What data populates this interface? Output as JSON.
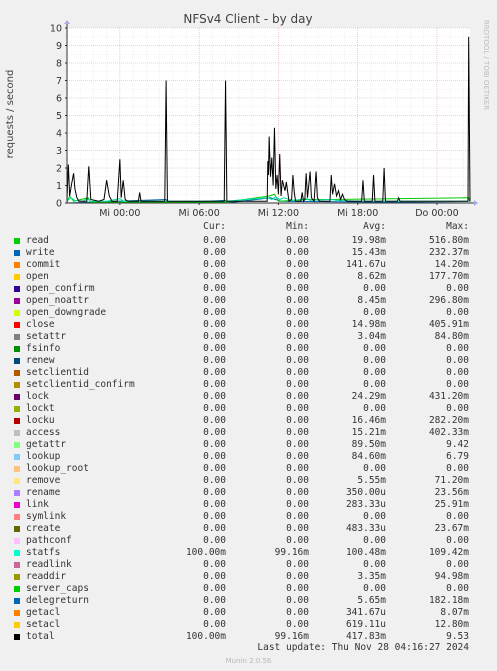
{
  "chart_data": {
    "type": "line",
    "title": "NFSv4 Client - by day",
    "ylabel": "requests / second",
    "side_label": "RRDTOOL / TOBI OETIKER",
    "ylim": [
      0,
      10
    ],
    "yticks": [
      "0",
      "1",
      "2",
      "3",
      "4",
      "5",
      "6",
      "7",
      "8",
      "9",
      "10"
    ],
    "xticks": [
      "Mi 00:00",
      "Mi 06:00",
      "Mi 12:00",
      "Mi 18:00",
      "Do 00:00"
    ],
    "grid": true,
    "x_range_hours": [
      0,
      30.5
    ],
    "xtick_hours": [
      4,
      10,
      16,
      22,
      28
    ],
    "series": [
      {
        "name": "total",
        "color": "#000000",
        "points": [
          [
            0.0,
            0.1
          ],
          [
            0.1,
            2.2
          ],
          [
            0.2,
            0.4
          ],
          [
            0.35,
            1.1
          ],
          [
            0.5,
            1.7
          ],
          [
            0.6,
            0.8
          ],
          [
            0.75,
            0.3
          ],
          [
            0.9,
            0.1
          ],
          [
            1.5,
            0.1
          ],
          [
            1.65,
            2.1
          ],
          [
            1.8,
            0.2
          ],
          [
            2.4,
            0.1
          ],
          [
            2.8,
            0.2
          ],
          [
            3.0,
            1.3
          ],
          [
            3.2,
            0.4
          ],
          [
            3.4,
            0.1
          ],
          [
            3.8,
            0.1
          ],
          [
            4.0,
            2.5
          ],
          [
            4.1,
            0.3
          ],
          [
            4.25,
            1.3
          ],
          [
            4.4,
            0.2
          ],
          [
            4.6,
            0.1
          ],
          [
            5.4,
            0.1
          ],
          [
            5.5,
            0.6
          ],
          [
            5.6,
            0.1
          ],
          [
            7.4,
            0.1
          ],
          [
            7.5,
            7.0
          ],
          [
            7.6,
            0.1
          ],
          [
            11.9,
            0.1
          ],
          [
            12.0,
            7.0
          ],
          [
            12.1,
            0.1
          ],
          [
            15.15,
            0.1
          ],
          [
            15.2,
            2.4
          ],
          [
            15.25,
            1.6
          ],
          [
            15.3,
            3.8
          ],
          [
            15.4,
            1.5
          ],
          [
            15.5,
            2.6
          ],
          [
            15.6,
            1.0
          ],
          [
            15.7,
            4.3
          ],
          [
            15.8,
            0.8
          ],
          [
            15.9,
            1.6
          ],
          [
            16.0,
            0.5
          ],
          [
            16.1,
            2.8
          ],
          [
            16.2,
            0.4
          ],
          [
            16.3,
            1.3
          ],
          [
            16.5,
            0.7
          ],
          [
            16.6,
            1.2
          ],
          [
            16.8,
            0.1
          ],
          [
            17.0,
            0.2
          ],
          [
            17.1,
            1.6
          ],
          [
            17.2,
            0.6
          ],
          [
            17.3,
            0.1
          ],
          [
            17.7,
            0.1
          ],
          [
            17.8,
            0.6
          ],
          [
            17.9,
            0.1
          ],
          [
            18.0,
            0.2
          ],
          [
            18.1,
            1.7
          ],
          [
            18.2,
            0.3
          ],
          [
            18.4,
            1.8
          ],
          [
            18.5,
            0.3
          ],
          [
            18.7,
            0.1
          ],
          [
            18.85,
            1.8
          ],
          [
            18.95,
            0.3
          ],
          [
            19.1,
            0.1
          ],
          [
            19.9,
            0.1
          ],
          [
            20.0,
            1.6
          ],
          [
            20.1,
            0.5
          ],
          [
            20.25,
            1.1
          ],
          [
            20.4,
            0.4
          ],
          [
            20.55,
            0.7
          ],
          [
            20.7,
            0.2
          ],
          [
            20.85,
            0.5
          ],
          [
            21.0,
            0.2
          ],
          [
            21.2,
            0.1
          ],
          [
            22.3,
            0.1
          ],
          [
            22.4,
            1.3
          ],
          [
            22.5,
            0.1
          ],
          [
            23.1,
            0.1
          ],
          [
            23.2,
            1.6
          ],
          [
            23.3,
            0.1
          ],
          [
            23.9,
            0.1
          ],
          [
            24.0,
            2.0
          ],
          [
            24.1,
            0.1
          ],
          [
            25.0,
            0.1
          ],
          [
            25.1,
            0.3
          ],
          [
            25.2,
            0.1
          ],
          [
            30.35,
            0.1
          ],
          [
            30.4,
            9.5
          ],
          [
            30.5,
            0.1
          ]
        ]
      },
      {
        "name": "statfs",
        "color": "#00e0a0",
        "points": [
          [
            0.0,
            0.12
          ],
          [
            0.3,
            0.3
          ],
          [
            0.6,
            0.15
          ],
          [
            1.2,
            0.1
          ],
          [
            1.5,
            0.25
          ],
          [
            1.8,
            0.1
          ],
          [
            3.0,
            0.1
          ],
          [
            4.0,
            0.25
          ],
          [
            4.3,
            0.1
          ],
          [
            7.5,
            0.1
          ],
          [
            12.0,
            0.1
          ],
          [
            15.2,
            0.3
          ],
          [
            15.5,
            0.2
          ],
          [
            15.8,
            0.35
          ],
          [
            16.1,
            0.2
          ],
          [
            16.4,
            0.3
          ],
          [
            17.1,
            0.15
          ],
          [
            18.1,
            0.25
          ],
          [
            18.4,
            0.15
          ],
          [
            20.0,
            0.2
          ],
          [
            20.4,
            0.15
          ],
          [
            22.4,
            0.1
          ],
          [
            30.4,
            0.1
          ]
        ]
      },
      {
        "name": "read",
        "color": "#00cc00",
        "points": [
          [
            0.0,
            0.05
          ],
          [
            0.2,
            0.4
          ],
          [
            0.5,
            0.1
          ],
          [
            1.6,
            0.3
          ],
          [
            1.8,
            0.05
          ],
          [
            7.5,
            0.05
          ],
          [
            12.0,
            0.05
          ],
          [
            15.3,
            0.4
          ],
          [
            15.7,
            0.5
          ],
          [
            16.0,
            0.1
          ],
          [
            18.2,
            0.2
          ],
          [
            20.1,
            0.2
          ],
          [
            30.4,
            0.3
          ],
          [
            30.5,
            0.05
          ]
        ]
      },
      {
        "name": "write",
        "color": "#0066b3",
        "points": [
          [
            0.0,
            0.0
          ],
          [
            7.5,
            0.2
          ],
          [
            7.6,
            0.0
          ],
          [
            12.0,
            0.15
          ],
          [
            12.1,
            0.0
          ],
          [
            15.4,
            0.3
          ],
          [
            15.8,
            0.2
          ],
          [
            16.2,
            0.1
          ],
          [
            30.5,
            0.0
          ]
        ]
      }
    ],
    "legend_headers": [
      "Cur:",
      "Min:",
      "Avg:",
      "Max:"
    ],
    "legend": [
      {
        "name": "read",
        "color": "#00cc00",
        "cur": "0.00",
        "min": "0.00",
        "avg": "19.98m",
        "max": "516.80m"
      },
      {
        "name": "write",
        "color": "#0066b3",
        "cur": "0.00",
        "min": "0.00",
        "avg": "15.43m",
        "max": "232.37m"
      },
      {
        "name": "commit",
        "color": "#ff8000",
        "cur": "0.00",
        "min": "0.00",
        "avg": "141.67u",
        "max": "14.20m"
      },
      {
        "name": "open",
        "color": "#ffcc00",
        "cur": "0.00",
        "min": "0.00",
        "avg": "8.62m",
        "max": "177.70m"
      },
      {
        "name": "open_confirm",
        "color": "#330099",
        "cur": "0.00",
        "min": "0.00",
        "avg": "0.00",
        "max": "0.00"
      },
      {
        "name": "open_noattr",
        "color": "#990099",
        "cur": "0.00",
        "min": "0.00",
        "avg": "8.45m",
        "max": "296.80m"
      },
      {
        "name": "open_downgrade",
        "color": "#ccff00",
        "cur": "0.00",
        "min": "0.00",
        "avg": "0.00",
        "max": "0.00"
      },
      {
        "name": "close",
        "color": "#ff0000",
        "cur": "0.00",
        "min": "0.00",
        "avg": "14.98m",
        "max": "405.91m"
      },
      {
        "name": "setattr",
        "color": "#808080",
        "cur": "0.00",
        "min": "0.00",
        "avg": "3.04m",
        "max": "84.80m"
      },
      {
        "name": "fsinfo",
        "color": "#008f00",
        "cur": "0.00",
        "min": "0.00",
        "avg": "0.00",
        "max": "0.00"
      },
      {
        "name": "renew",
        "color": "#00487d",
        "cur": "0.00",
        "min": "0.00",
        "avg": "0.00",
        "max": "0.00"
      },
      {
        "name": "setclientid",
        "color": "#b35a00",
        "cur": "0.00",
        "min": "0.00",
        "avg": "0.00",
        "max": "0.00"
      },
      {
        "name": "setclientid_confirm",
        "color": "#b38f00",
        "cur": "0.00",
        "min": "0.00",
        "avg": "0.00",
        "max": "0.00"
      },
      {
        "name": "lock",
        "color": "#6b006b",
        "cur": "0.00",
        "min": "0.00",
        "avg": "24.29m",
        "max": "431.20m"
      },
      {
        "name": "lockt",
        "color": "#8fb300",
        "cur": "0.00",
        "min": "0.00",
        "avg": "0.00",
        "max": "0.00"
      },
      {
        "name": "locku",
        "color": "#b30000",
        "cur": "0.00",
        "min": "0.00",
        "avg": "16.46m",
        "max": "282.20m"
      },
      {
        "name": "access",
        "color": "#bebebe",
        "cur": "0.00",
        "min": "0.00",
        "avg": "15.21m",
        "max": "402.33m"
      },
      {
        "name": "getattr",
        "color": "#80ff80",
        "cur": "0.00",
        "min": "0.00",
        "avg": "89.50m",
        "max": "9.42"
      },
      {
        "name": "lookup",
        "color": "#80c9ff",
        "cur": "0.00",
        "min": "0.00",
        "avg": "84.60m",
        "max": "6.79"
      },
      {
        "name": "lookup_root",
        "color": "#ffc080",
        "cur": "0.00",
        "min": "0.00",
        "avg": "0.00",
        "max": "0.00"
      },
      {
        "name": "remove",
        "color": "#ffe680",
        "cur": "0.00",
        "min": "0.00",
        "avg": "5.55m",
        "max": "71.20m"
      },
      {
        "name": "rename",
        "color": "#aa80ff",
        "cur": "0.00",
        "min": "0.00",
        "avg": "350.00u",
        "max": "23.56m"
      },
      {
        "name": "link",
        "color": "#ee00cc",
        "cur": "0.00",
        "min": "0.00",
        "avg": "283.33u",
        "max": "25.91m"
      },
      {
        "name": "symlink",
        "color": "#ff8080",
        "cur": "0.00",
        "min": "0.00",
        "avg": "0.00",
        "max": "0.00"
      },
      {
        "name": "create",
        "color": "#666600",
        "cur": "0.00",
        "min": "0.00",
        "avg": "483.33u",
        "max": "23.67m"
      },
      {
        "name": "pathconf",
        "color": "#ffbfff",
        "cur": "0.00",
        "min": "0.00",
        "avg": "0.00",
        "max": "0.00"
      },
      {
        "name": "statfs",
        "color": "#00ffcc",
        "cur": "100.00m",
        "min": "99.16m",
        "avg": "100.48m",
        "max": "109.42m"
      },
      {
        "name": "readlink",
        "color": "#cc6699",
        "cur": "0.00",
        "min": "0.00",
        "avg": "0.00",
        "max": "0.00"
      },
      {
        "name": "readdir",
        "color": "#999900",
        "cur": "0.00",
        "min": "0.00",
        "avg": "3.35m",
        "max": "94.98m"
      },
      {
        "name": "server_caps",
        "color": "#00cc00",
        "cur": "0.00",
        "min": "0.00",
        "avg": "0.00",
        "max": "0.00"
      },
      {
        "name": "delegreturn",
        "color": "#0066b3",
        "cur": "0.00",
        "min": "0.00",
        "avg": "5.65m",
        "max": "182.18m"
      },
      {
        "name": "getacl",
        "color": "#ff8000",
        "cur": "0.00",
        "min": "0.00",
        "avg": "341.67u",
        "max": "8.07m"
      },
      {
        "name": "setacl",
        "color": "#ffcc00",
        "cur": "0.00",
        "min": "0.00",
        "avg": "619.11u",
        "max": "12.80m"
      },
      {
        "name": "total",
        "color": "#000000",
        "cur": "100.00m",
        "min": "99.16m",
        "avg": "417.83m",
        "max": "9.53"
      }
    ]
  },
  "footer": {
    "last_update": "Last update: Thu Nov 28 04:16:27 2024",
    "version": "Munin 2.0.56"
  }
}
